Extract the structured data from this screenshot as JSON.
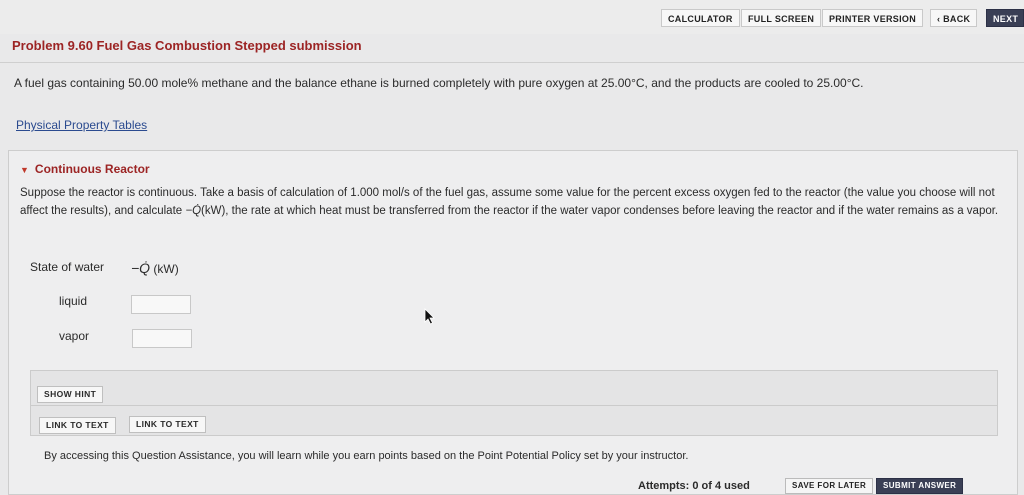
{
  "toolbar": {
    "calculator": "CALCULATOR",
    "full_screen": "FULL SCREEN",
    "printer_version": "PRINTER VERSION",
    "back": "BACK",
    "next": "NEXT"
  },
  "problem": {
    "title": "Problem 9.60 Fuel Gas Combustion Stepped submission",
    "intro": "A fuel gas containing 50.00 mole% methane and the balance ethane is burned completely with pure oxygen at 25.00°C, and the products are cooled to 25.00°C.",
    "link": "Physical Property Tables"
  },
  "section": {
    "heading": "Continuous Reactor",
    "paragraph_pre": "Suppose the reactor is continuous. Take a basis of calculation of 1.000 mol/s of the fuel gas, assume some value for the percent excess oxygen fed to the reactor (the value you choose will not affect the results), and calculate ",
    "paragraph_q": "−Q̇",
    "paragraph_post": "(kW), the rate at which heat must be transferred from the reactor if the water vapor condenses before leaving the reactor and if the water remains as a vapor."
  },
  "table": {
    "col_state": "State of water",
    "col_q": "−Q̇",
    "col_q_unit": "(kW)",
    "rows": [
      {
        "label": "liquid",
        "value": ""
      },
      {
        "label": "vapor",
        "value": ""
      }
    ]
  },
  "assistance": {
    "show_hint": "SHOW HINT",
    "link_to_text_1": "LINK TO TEXT",
    "link_to_text_2": "LINK TO TEXT",
    "policy": "By accessing this Question Assistance, you will learn while you earn points based on the Point Potential Policy set by your instructor."
  },
  "footer": {
    "attempts": "Attempts: 0 of 4 used",
    "save_for_later": "SAVE FOR LATER",
    "submit_answer": "SUBMIT ANSWER"
  },
  "icons": {
    "back": "chevron-left-icon",
    "collapse": "triangle-down-icon",
    "cursor": "mouse-pointer-icon"
  },
  "colors": {
    "title_red": "#9c2424",
    "link_blue": "#2a4a8f",
    "dark_button": "#3a3f55"
  }
}
